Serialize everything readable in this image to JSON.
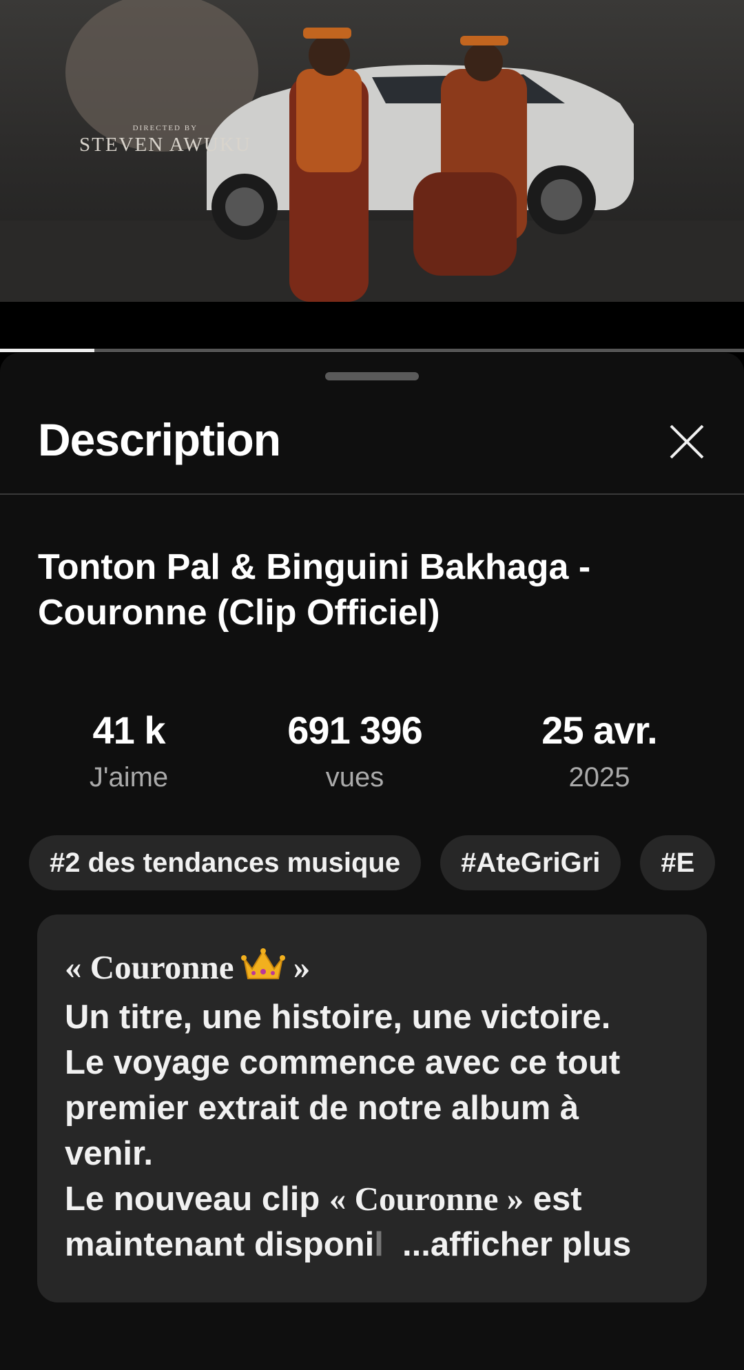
{
  "video": {
    "credit_small": "DIRECTED BY",
    "credit_big": "STEVEN AWUKU",
    "progress": 0.127
  },
  "sheet": {
    "title": "Description",
    "close_icon": "close-icon"
  },
  "video_title": {
    "line1": "Tonton Pal & Binguini Bakhaga -",
    "line2": "Couronne (Clip Officiel)"
  },
  "stats": [
    {
      "value": "41 k",
      "label": "J'aime"
    },
    {
      "value": "691 396",
      "label": "vues"
    },
    {
      "value": "25 avr.",
      "label": "2025"
    }
  ],
  "chips": [
    "#2 des tendances musique",
    "#AteGriGri",
    "#E"
  ],
  "description": {
    "quote_open": "« ",
    "quote_word": "Couronne",
    "crown_icon": "crown-emoji",
    "quote_close": " »",
    "line2": "Un titre, une histoire, une victoire.",
    "line3": "Le voyage commence avec ce tout",
    "line4": "premier extrait de notre album à",
    "line5": "venir.",
    "line6_a": "Le nouveau clip ",
    "line6_b": "« Couronne »",
    "line6_c": " est",
    "line7_a": "maintenant disponi",
    "line7_fade": "l",
    "more_label": "...afficher plus"
  }
}
